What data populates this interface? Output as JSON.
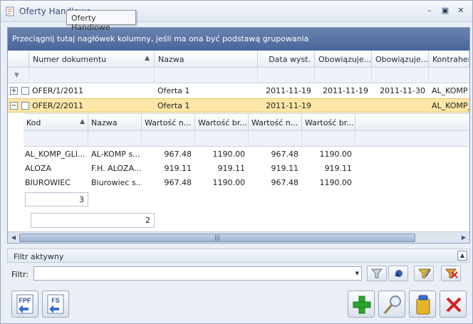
{
  "window": {
    "title": "Oferty Handlowe"
  },
  "grid": {
    "group_hint": "Przeciągnij tutaj nagłówek kolumny, jeśli ma ona być podstawą grupowania",
    "tooltip": "Oferty Handlowe",
    "columns": [
      "Numer dokumentu",
      "Nazwa",
      "Data wyst.",
      "Obowiązuje...",
      "Obowiązuje...",
      "Kontrahen"
    ],
    "rows": [
      {
        "numer": "OFER/1/2011",
        "nazwa": "Oferta 1",
        "data": "2011-11-19",
        "od": "2011-11-19",
        "do": "2011-11-30",
        "kontrahent": "AL_KOMP -"
      },
      {
        "numer": "OFER/2/2011",
        "nazwa": "Oferta 1",
        "data": "2011-11-19",
        "od": "",
        "do": "",
        "kontrahent": "AL_KOMP_"
      }
    ],
    "footer_count": "2"
  },
  "subgrid": {
    "columns": [
      "Kod",
      "Nazwa",
      "Wartość n...",
      "Wartość br...",
      "Wartość n...",
      "Wartość br..."
    ],
    "rows": [
      {
        "kod": "AL_KOMP_GLI...",
        "nazwa": "AL-KOMP s...",
        "v1": "967.48",
        "v2": "1190.00",
        "v3": "967.48",
        "v4": "1190.00"
      },
      {
        "kod": "ALOZA",
        "nazwa": "F.H. ALOZA...",
        "v1": "919.11",
        "v2": "919.11",
        "v3": "919.11",
        "v4": "919.11"
      },
      {
        "kod": "BIUROWIEC",
        "nazwa": "Biurowiec s...",
        "v1": "967.48",
        "v2": "1190.00",
        "v3": "967.48",
        "v4": "1190.00"
      }
    ],
    "footer_count": "3"
  },
  "filter": {
    "panel_label": "Filtr aktywny",
    "label": "Filtr:",
    "value": ""
  },
  "buttons": {
    "fpf": "FPF",
    "fs": "FS"
  },
  "colors": {
    "header_blue": "#4a6599",
    "selected_row": "#fde7a8",
    "add_green": "#2aa52a",
    "delete_red": "#d42020"
  }
}
